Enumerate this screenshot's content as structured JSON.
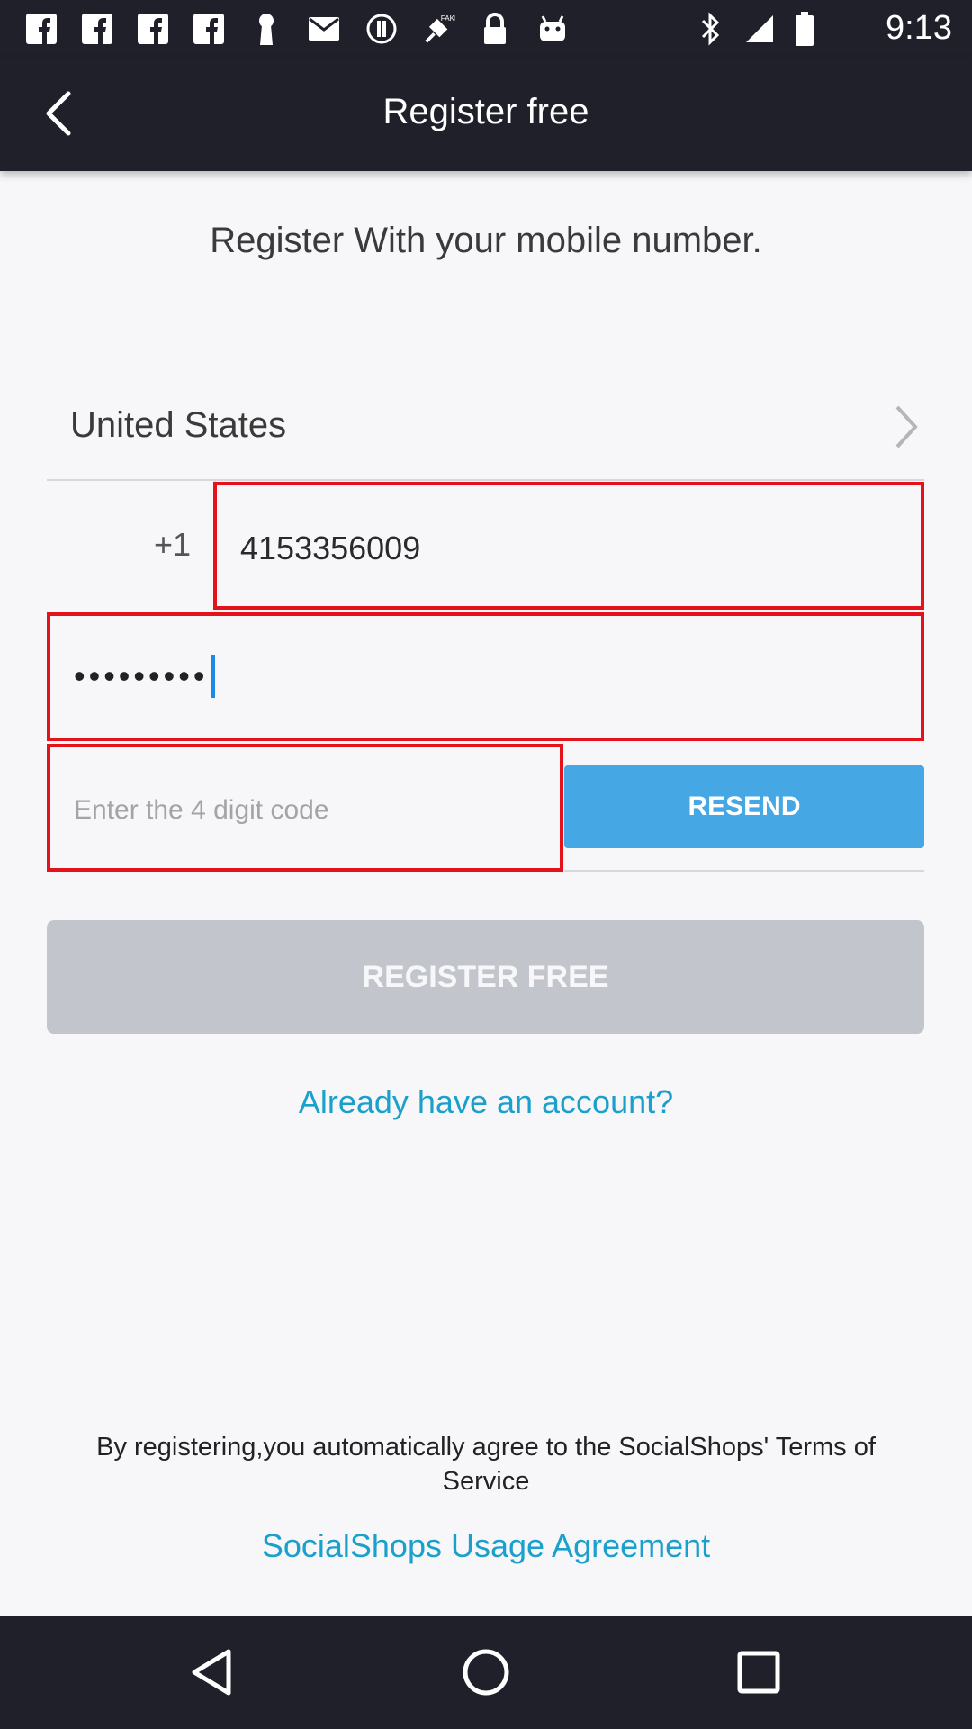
{
  "status_bar": {
    "time": "9:13",
    "icons": [
      "facebook-icon",
      "facebook-icon",
      "facebook-icon",
      "keyhole-icon",
      "mail-icon",
      "alert-icon",
      "satellite-fake-gps-icon",
      "lock-icon",
      "android-icon",
      "bluetooth-icon",
      "signal-icon",
      "battery-icon"
    ]
  },
  "app_bar": {
    "title": "Register free",
    "back_icon": "back-arrow-icon"
  },
  "form": {
    "headline": "Register With your mobile number.",
    "country": "United States",
    "country_prefix": "+1",
    "phone_value": "4153356009",
    "password_mask": "•••••••••",
    "code_placeholder": "Enter the 4 digit code",
    "resend_label": "RESEND",
    "register_label": "REGISTER FREE",
    "login_link": "Already have an account?"
  },
  "footer": {
    "terms_text": "By registering,you automatically agree to the SocialShops' Terms of Service",
    "agreement_link": "SocialShops Usage Agreement"
  },
  "nav_bar": {
    "buttons": [
      "back-triangle-icon",
      "home-circle-icon",
      "recents-square-icon"
    ]
  },
  "colors": {
    "bar_bg": "#1f2029",
    "page_bg": "#f7f7f9",
    "accent_blue": "#45a7e4",
    "link": "#1ba0cc",
    "highlight_red": "#e3121b",
    "disabled_button": "#c3c5cc"
  }
}
